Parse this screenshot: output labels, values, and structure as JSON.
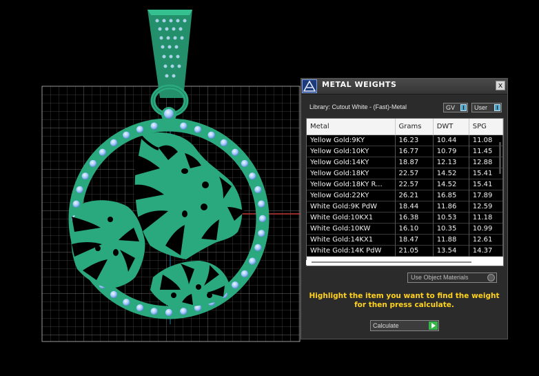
{
  "panel": {
    "title": "METAL WEIGHTS",
    "close_label": "x",
    "library_label": "Library: Cutout White - (Fast)-Metal",
    "gv_select": "GV",
    "user_select": "User",
    "use_object_materials": "Use Object Materials",
    "hint": "Highlight the item you want to find the weight for then press calculate.",
    "calculate_label": "Calculate"
  },
  "table": {
    "headers": [
      "Metal",
      "Grams",
      "DWT",
      "SPG"
    ],
    "rows": [
      [
        "Yellow Gold:9KY",
        "16.23",
        "10.44",
        "11.08"
      ],
      [
        "Yellow Gold:10KY",
        "16.77",
        "10.79",
        "11.45"
      ],
      [
        "Yellow Gold:14KY",
        "18.87",
        "12.13",
        "12.88"
      ],
      [
        "Yellow Gold:18KY",
        "22.57",
        "14.52",
        "15.41"
      ],
      [
        "Yellow Gold:18KY R...",
        "22.57",
        "14.52",
        "15.41"
      ],
      [
        "Yellow Gold:22KY",
        "26.21",
        "16.85",
        "17.89"
      ],
      [
        "White Gold:9K PdW",
        "18.44",
        "11.86",
        "12.59"
      ],
      [
        "White Gold:10KX1",
        "16.38",
        "10.53",
        "11.18"
      ],
      [
        "White Gold:10KW",
        "16.10",
        "10.35",
        "10.99"
      ],
      [
        "White Gold:14KX1",
        "18.47",
        "11.88",
        "12.61"
      ],
      [
        "White Gold:14K PdW",
        "21.05",
        "13.54",
        "14.37"
      ]
    ]
  },
  "colors": {
    "metal_green": "#2aa87e",
    "stone_blue": "#9ec8ff",
    "grid": "#444444",
    "hint_yellow": "#ffd21f"
  }
}
